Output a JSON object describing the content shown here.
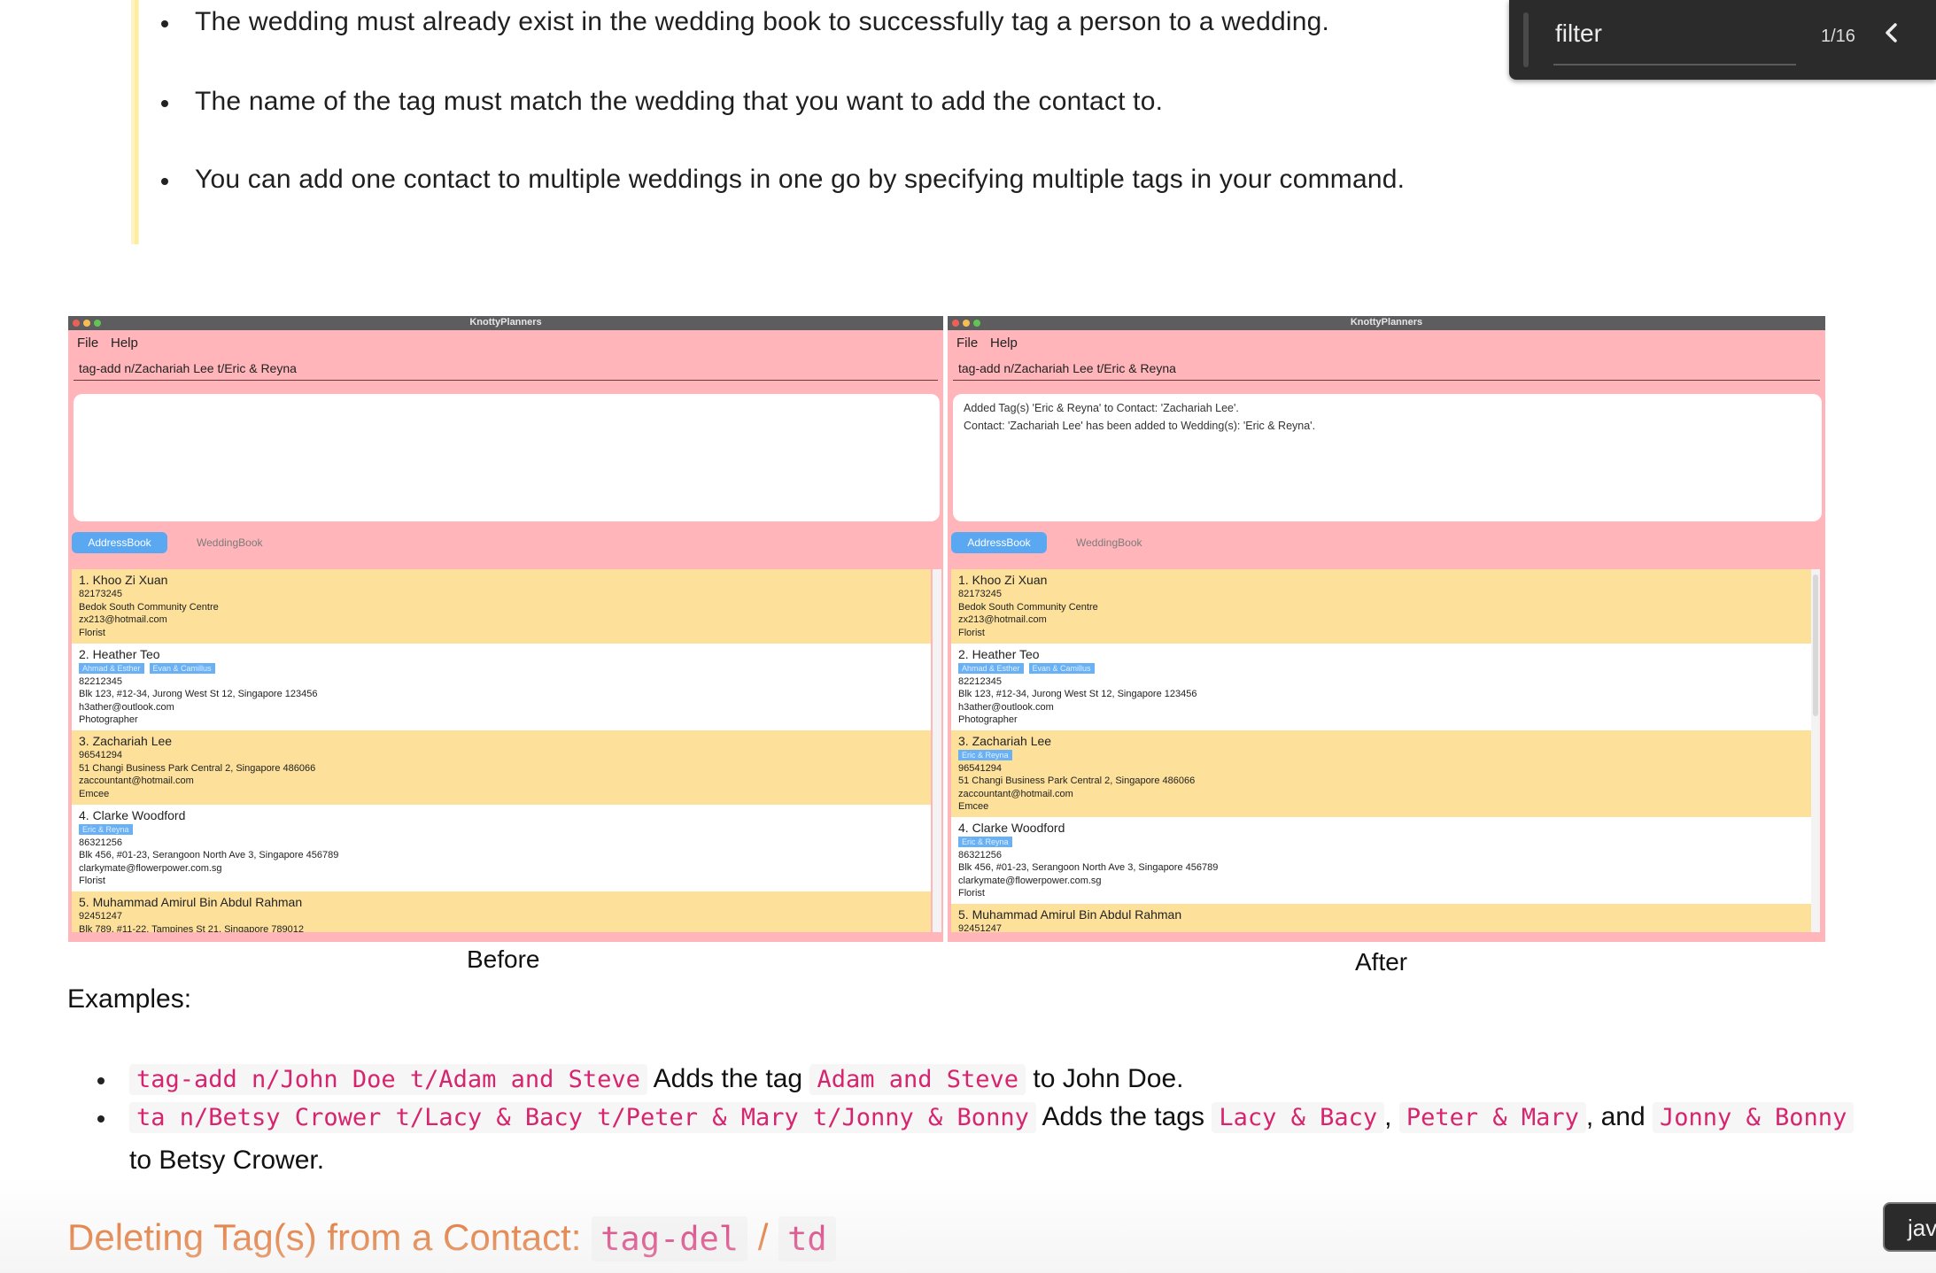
{
  "tips": [
    "The wedding must already exist in the wedding book to successfully tag a person to a wedding.",
    "The name of the tag must match the wedding that you want to add the contact to.",
    "You can add one contact to multiple weddings in one go by specifying multiple tags in your command."
  ],
  "app": {
    "window_title": "KnottyPlanners",
    "menu": [
      "File",
      "Help"
    ],
    "tabs": [
      "AddressBook",
      "WeddingBook"
    ]
  },
  "before": {
    "command": "tag-add n/Zachariah Lee t/Eric & Reyna",
    "result_lines": [],
    "caption": "Before",
    "contacts": [
      {
        "name": "1. Khoo Zi Xuan",
        "tags": [],
        "lines": [
          "82173245",
          "Bedok South Community Centre",
          "zx213@hotmail.com",
          "Florist"
        ]
      },
      {
        "name": "2. Heather Teo",
        "tags": [
          "Ahmad & Esther",
          "Evan & Camillus"
        ],
        "lines": [
          "82212345",
          "Blk 123, #12-34, Jurong West St 12, Singapore 123456",
          "h3ather@outlook.com",
          "Photographer"
        ]
      },
      {
        "name": "3. Zachariah Lee",
        "tags": [],
        "lines": [
          "96541294",
          "51 Changi Business Park Central 2, Singapore 486066",
          "zaccountant@hotmail.com",
          "Emcee"
        ]
      },
      {
        "name": "4. Clarke Woodford",
        "tags": [
          "Eric & Reyna"
        ],
        "lines": [
          "86321256",
          "Blk 456, #01-23, Serangoon North Ave 3, Singapore 456789",
          "clarkymate@flowerpower.com.sg",
          "Florist"
        ]
      },
      {
        "name": "5. Muhammad Amirul Bin Abdul Rahman",
        "tags": [],
        "lines": [
          "92451247",
          "Blk 789, #11-22, Tampines St 21, Singapore 789012"
        ]
      }
    ]
  },
  "after": {
    "command": "tag-add n/Zachariah Lee t/Eric & Reyna",
    "result_lines": [
      "Added Tag(s) 'Eric & Reyna' to Contact: 'Zachariah Lee'.",
      "Contact: 'Zachariah Lee' has been added to Wedding(s): 'Eric & Reyna'."
    ],
    "caption": "After",
    "contacts": [
      {
        "name": "1. Khoo Zi Xuan",
        "tags": [],
        "lines": [
          "82173245",
          "Bedok South Community Centre",
          "zx213@hotmail.com",
          "Florist"
        ]
      },
      {
        "name": "2. Heather Teo",
        "tags": [
          "Ahmad & Esther",
          "Evan & Camillus"
        ],
        "lines": [
          "82212345",
          "Blk 123, #12-34, Jurong West St 12, Singapore 123456",
          "h3ather@outlook.com",
          "Photographer"
        ]
      },
      {
        "name": "3. Zachariah Lee",
        "tags": [
          "Eric & Reyna"
        ],
        "lines": [
          "96541294",
          "51 Changi Business Park Central 2, Singapore 486066",
          "zaccountant@hotmail.com",
          "Emcee"
        ]
      },
      {
        "name": "4. Clarke Woodford",
        "tags": [
          "Eric & Reyna"
        ],
        "lines": [
          "86321256",
          "Blk 456, #01-23, Serangoon North Ave 3, Singapore 456789",
          "clarkymate@flowerpower.com.sg",
          "Florist"
        ]
      },
      {
        "name": "5. Muhammad Amirul Bin Abdul Rahman",
        "tags": [],
        "lines": [
          "92451247"
        ]
      }
    ]
  },
  "examples": {
    "heading": "Examples:",
    "ex1": {
      "code": "tag-add n/John Doe t/Adam and Steve",
      "t1": "Adds the tag",
      "code2": "Adam and Steve",
      "t2": "to John Doe."
    },
    "ex2": {
      "code": "ta n/Betsy Crower t/Lacy & Bacy t/Peter & Mary t/Jonny & Bonny",
      "t1": "Adds the tags",
      "c1": "Lacy & Bacy",
      "comma1": ",",
      "c2": "Peter & Mary",
      "and": ", and",
      "c3": "Jonny & Bonny",
      "t2": "to Betsy Crower."
    }
  },
  "section": {
    "title": "Deleting Tag(s) from a Contact:",
    "code1": "tag-del",
    "sep": "/",
    "code2": "td"
  },
  "find": {
    "query": "filter",
    "count": "1/16",
    "prev_icon": "chevron-left-icon"
  },
  "tooltip": {
    "text": "jav"
  }
}
